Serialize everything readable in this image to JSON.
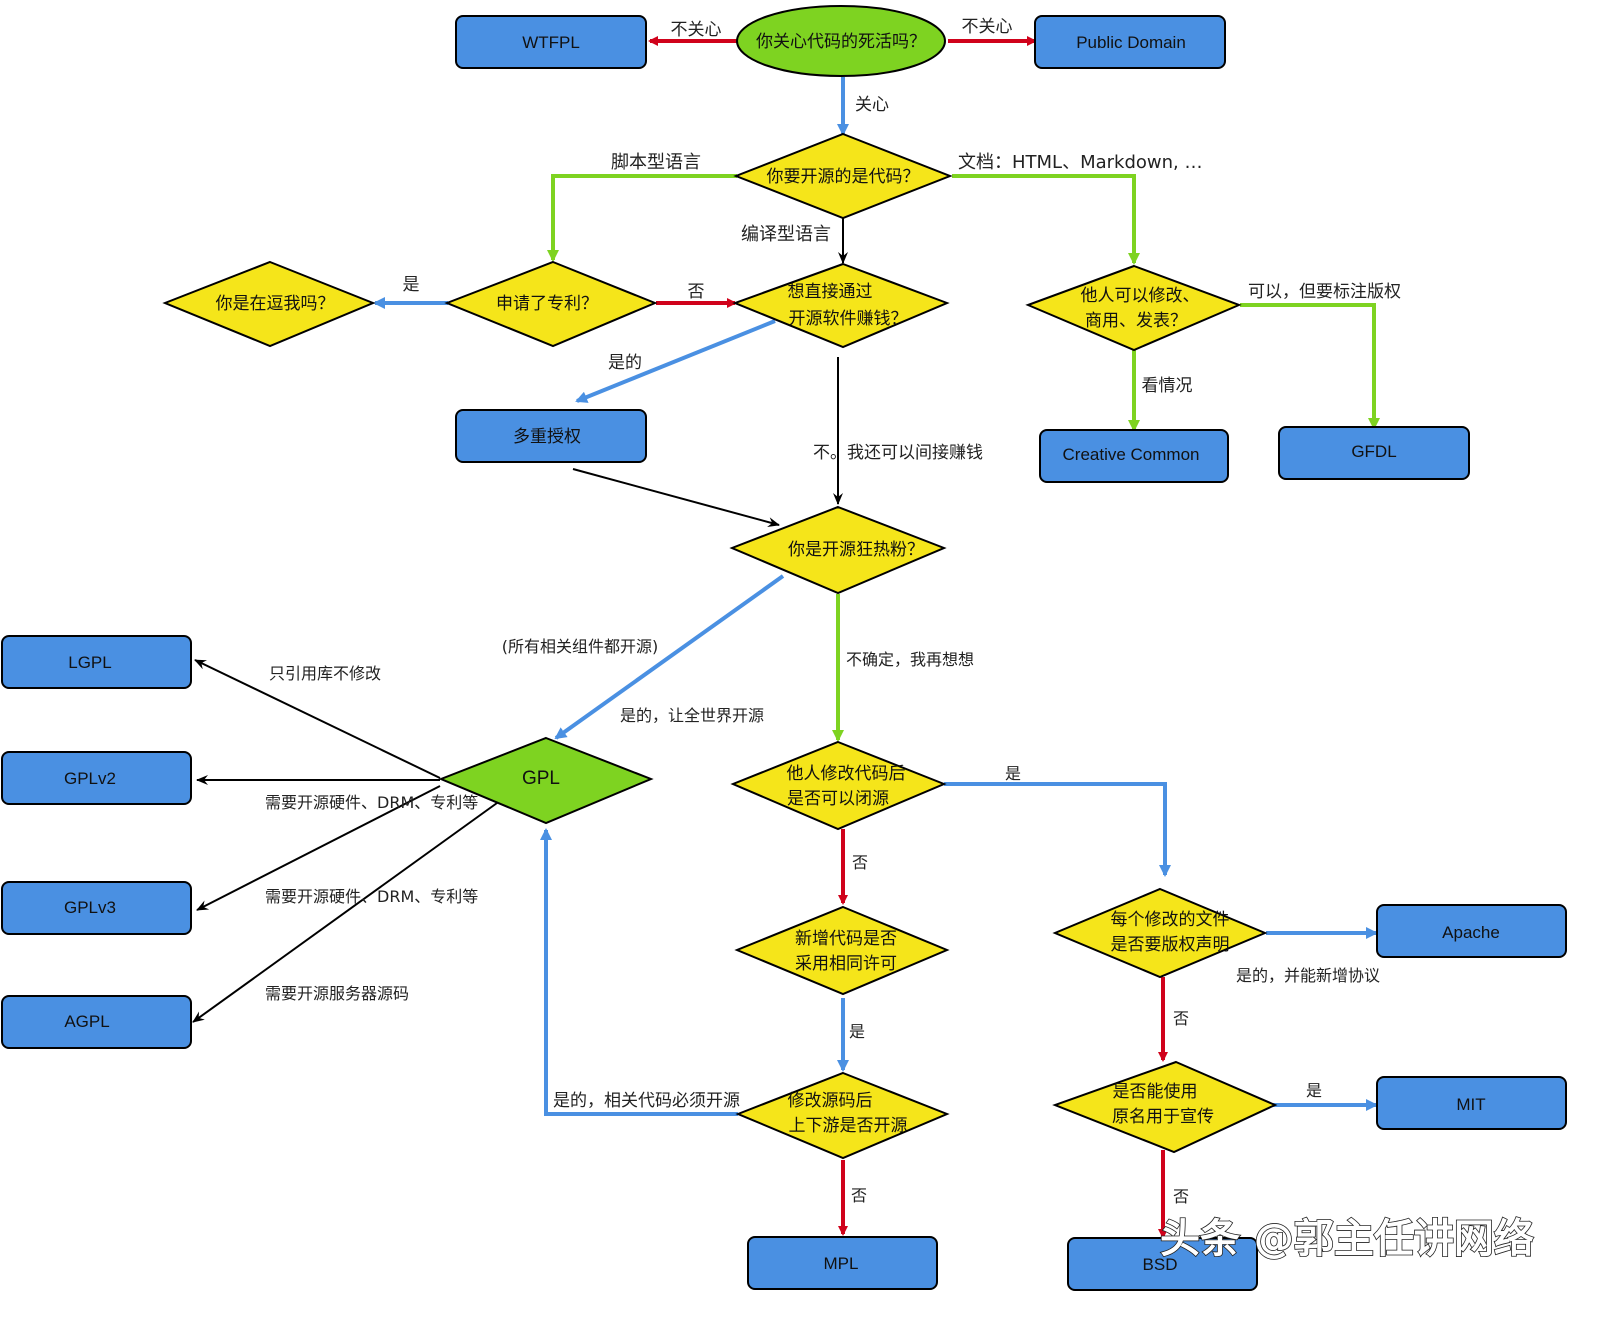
{
  "colors": {
    "box_fill": "#4a90e2",
    "decision_fill": "#f5e51a",
    "start_fill": "#7ed321",
    "gpl_fill": "#7ed321",
    "stroke": "#000000",
    "edge_red": "#d0021b",
    "edge_blue": "#4a90e2",
    "edge_green": "#7ed321",
    "edge_black": "#000000"
  },
  "nodes": {
    "start": "你关心代码的死活吗？",
    "wtfpl": "WTFPL",
    "public_domain": "Public Domain",
    "is_code": "你要开源的是代码？",
    "patent": "申请了专利？",
    "kidding": "你是在逗我吗？",
    "make_money": [
      "想直接通过",
      "开源软件赚钱？"
    ],
    "dual_license": "多重授权",
    "others_modify": [
      "他人可以修改、",
      "商用、发表？"
    ],
    "creative_common": "Creative Common",
    "gfdl": "GFDL",
    "fanatic": "你是开源狂热粉？",
    "gpl": "GPL",
    "lgpl": "LGPL",
    "gplv2": "GPLv2",
    "gplv3": "GPLv3",
    "agpl": "AGPL",
    "closed_source": [
      "他人修改代码后",
      "是否可以闭源"
    ],
    "same_license": [
      "新增代码是否",
      "采用相同许可"
    ],
    "upstream": [
      "修改源码后",
      "上下游是否开源"
    ],
    "mpl": "MPL",
    "copyright_notice": [
      "每个修改的文件",
      "是否要版权声明"
    ],
    "apache": "Apache",
    "use_name": [
      "是否能使用",
      "原名用于宣传"
    ],
    "mit": "MIT",
    "bsd": "BSD"
  },
  "edge_labels": {
    "not_care_left": "不关心",
    "not_care_right": "不关心",
    "care": "关心",
    "script_lang": "脚本型语言",
    "compiled_lang": "编译型语言",
    "docs": "文档：HTML、Markdown, …",
    "patent_yes": "是",
    "patent_no": "否",
    "money_yes": "是的",
    "money_no": "不。我还可以间接赚钱",
    "modify_yes_attr": "可以，但要标注版权",
    "modify_depends": "看情况",
    "all_components": "(所有相关组件都开源)",
    "fanatic_yes": "是的，让全世界开源",
    "fanatic_unsure": "不确定，我再想想",
    "lgpl_label": "只引用库不修改",
    "gplv2_label": "需要开源硬件、DRM、专利等",
    "gplv3_label": "需要开源硬件、DRM、专利等",
    "agpl_label": "需要开源服务器源码",
    "closed_yes": "是",
    "closed_no": "否",
    "same_yes": "是",
    "upstream_yes": "是的，相关代码必须开源",
    "upstream_no": "否",
    "notice_yes": "是的，并能新增协议",
    "notice_no": "否",
    "name_yes": "是",
    "name_no": "否"
  },
  "watermark": "头条 @郭主任讲网络"
}
